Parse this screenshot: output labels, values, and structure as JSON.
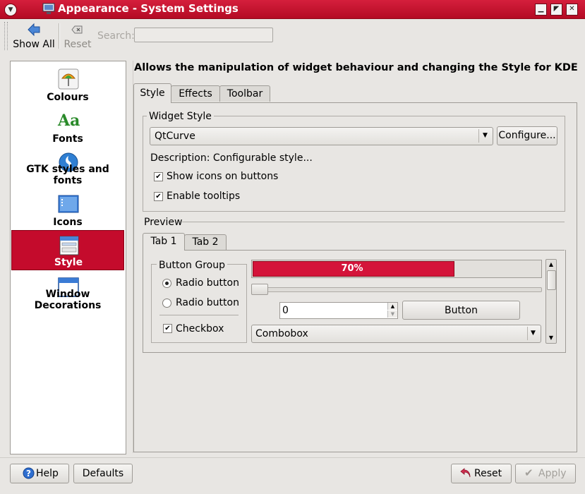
{
  "window": {
    "title": "Appearance - System Settings",
    "controls": [
      "minimize",
      "maximize",
      "close"
    ]
  },
  "toolbar": {
    "show_all_label": "Show All",
    "reset_label": "Reset",
    "search_label": "Search:",
    "search_value": ""
  },
  "sidebar": {
    "items": [
      {
        "label": "Colours",
        "icon": "colours-icon",
        "selected": false
      },
      {
        "label": "Fonts",
        "icon": "fonts-icon",
        "selected": false
      },
      {
        "label": "GTK styles and fonts",
        "icon": "gtk-icon",
        "selected": false
      },
      {
        "label": "Icons",
        "icon": "icons-icon",
        "selected": false
      },
      {
        "label": "Style",
        "icon": "style-icon",
        "selected": true
      },
      {
        "label": "Window Decorations",
        "icon": "window-decorations-icon",
        "selected": false
      }
    ],
    "fonts_glyph": "Aa"
  },
  "main": {
    "heading": "Allows the manipulation of widget behaviour and changing the Style for KDE",
    "tabs": [
      {
        "label": "Style",
        "active": true
      },
      {
        "label": "Effects",
        "active": false
      },
      {
        "label": "Toolbar",
        "active": false
      }
    ],
    "widget_style": {
      "group_label": "Widget Style",
      "selected_style": "QtCurve",
      "configure_label": "Configure...",
      "description": "Description: Configurable style...",
      "show_icons_label": "Show icons on buttons",
      "show_icons_checked": true,
      "tooltips_label": "Enable tooltips",
      "tooltips_checked": true
    },
    "preview": {
      "label": "Preview",
      "tabs": [
        {
          "label": "Tab 1",
          "active": true
        },
        {
          "label": "Tab 2",
          "active": false
        }
      ],
      "button_group": {
        "label": "Button Group",
        "radio1": "Radio button",
        "radio1_checked": true,
        "radio2": "Radio button",
        "radio2_checked": false,
        "checkbox": "Checkbox",
        "checkbox_checked": true
      },
      "progress_text": "70%",
      "progress_value": 0.7,
      "slider_value": 0,
      "spinbox_value": "0",
      "button_label": "Button",
      "combobox_value": "Combobox"
    }
  },
  "footer": {
    "help_label": "Help",
    "defaults_label": "Defaults",
    "reset_label": "Reset",
    "apply_label": "Apply"
  },
  "colors": {
    "accent": "#c40b2c",
    "titlebar": "#c8102e",
    "window_bg": "#e8e6e3"
  }
}
